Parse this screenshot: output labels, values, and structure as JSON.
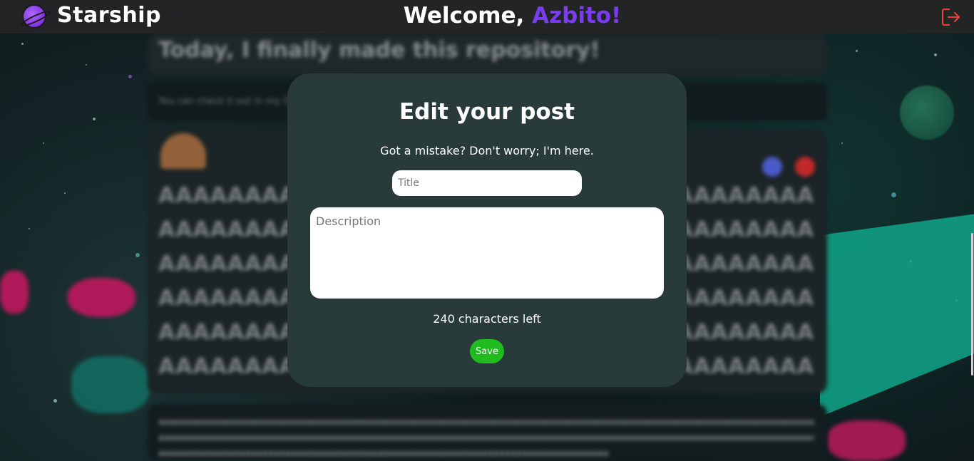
{
  "header": {
    "app_name": "Starship",
    "welcome_prefix": "Welcome, ",
    "username": "Azbito!",
    "logout_icon": "logout-icon"
  },
  "feed": {
    "post_title": "Today, I finally made this repository!",
    "post_subtitle": "You can check it out in my GitHub profile, I'm very happy to share this moment! :)",
    "body_lines": [
      "AAAAAAAAAAAAAAAAAAAAAAAAAAAAAAAAAAAAAAAAAAAAAA",
      "AAAAAAAAAAAAAAAAAAAAAAAAAAAAAAAAAAAAAAAAAAAAAA",
      "AAAAAAAAAAAAAAAAAAAAAAAAAAAAAAAAAAAAAAAAAAAAAA",
      "AAAAAAAAAAAAAAAAAAAAAAAAAAAAAAAAAAAAAAAAAAAAAA",
      "AAAAAAAAAAAAAAAAAAAAAAAAAAAAAAAAAAAAAAAAAAAAAA",
      "AAAAAAAAAAAAAAAAAAAAAAAAAAAAAAAAAAAAAAAAAAAAAA"
    ],
    "small_lines": [
      "aaaaaaaaaaaaaaaaaaaaaaaaaaaaaaaaaaaaaaaaaaaaaaaaaaaaaaaaaaaaaaaaaaaaaaaaaaaaaaaaaaaaaaaaaaaaaaaaaaaaaaaaaaaaaaaaaaa",
      "aaaaaaaaaaaaaaaaaaaaaaaaaaaaaaaaaaaaaaaaaaaaaaaaaaaaaaaaaaaaaaaaaaaaaaaaaaaaaaaaaaaaaaaaaaaaaaaaaaaaaaaaaaaaaaaaaaa",
      "aaaaaaaaaaaaaaaaaaaaaaaaaaaaaaaaaaaaaaaaaaaaaaaaaaaaaaaaaaaaaaaaaaaaaaaaaaaaaa"
    ]
  },
  "modal": {
    "title": "Edit your post",
    "subtitle": "Got a mistake? Don't worry; I'm here.",
    "title_placeholder": "Title",
    "title_value": "",
    "description_placeholder": "Description",
    "description_value": "",
    "chars_left": "240 characters left",
    "save_label": "Save"
  },
  "colors": {
    "accent_purple": "#7a3cf0",
    "save_green": "#1fbb1f",
    "modal_bg": "#283a39",
    "logout_red": "#e0413a"
  }
}
